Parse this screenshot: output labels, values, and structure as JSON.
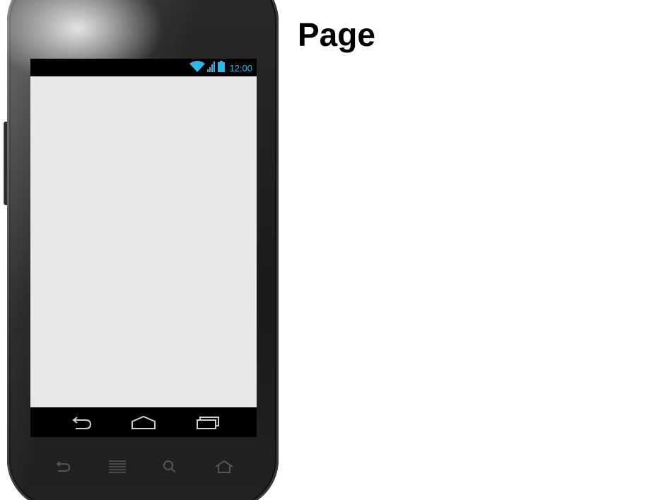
{
  "page": {
    "title": "Page"
  },
  "device": {
    "status_bar": {
      "time": "12:00",
      "time_color": "#33b5e5",
      "icons": [
        "wifi-icon",
        "cell-signal-icon",
        "battery-icon"
      ]
    },
    "screen_background": "#e8e8e8",
    "nav_buttons": [
      "back-icon",
      "home-icon",
      "recent-apps-icon"
    ],
    "hardware_keys": [
      "back-key-icon",
      "menu-key-icon",
      "search-key-icon",
      "home-key-icon"
    ]
  }
}
